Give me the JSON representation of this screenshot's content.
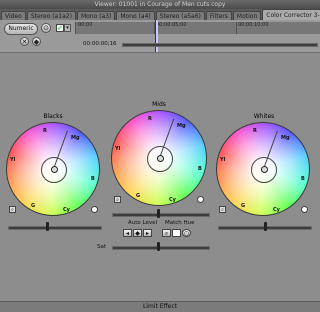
{
  "window": {
    "title": "Viewer: 01001 in Courage of Men cuts copy"
  },
  "tabs": [
    {
      "label": "Video"
    },
    {
      "label": "Stereo (a1a2)"
    },
    {
      "label": "Mono (a3)"
    },
    {
      "label": "Mono (a4)"
    },
    {
      "label": "Stereo (a5a6)"
    },
    {
      "label": "Filters"
    },
    {
      "label": "Motion"
    },
    {
      "label": "Color Corrector 3-way"
    }
  ],
  "controls": {
    "numeric_label": "Numeric",
    "timecode": "00:00:00;16",
    "ruler_labels": [
      "00:00",
      "00:00:05;00",
      "00:00:10;00"
    ]
  },
  "wheels": [
    {
      "label": "Blacks",
      "hues": [
        "R",
        "Mg",
        "B",
        "Cy",
        "G",
        "Yl"
      ]
    },
    {
      "label": "Mids",
      "hues": [
        "R",
        "Mg",
        "B",
        "Cy",
        "G",
        "Yl"
      ]
    },
    {
      "label": "Whites",
      "hues": [
        "R",
        "Mg",
        "B",
        "Cy",
        "G",
        "Yl"
      ]
    }
  ],
  "center": {
    "auto_level_label": "Auto Level",
    "match_hue_label": "Match Hue",
    "sat_label": "Sat"
  },
  "footer": {
    "limit_effect_label": "Limit Effect"
  }
}
